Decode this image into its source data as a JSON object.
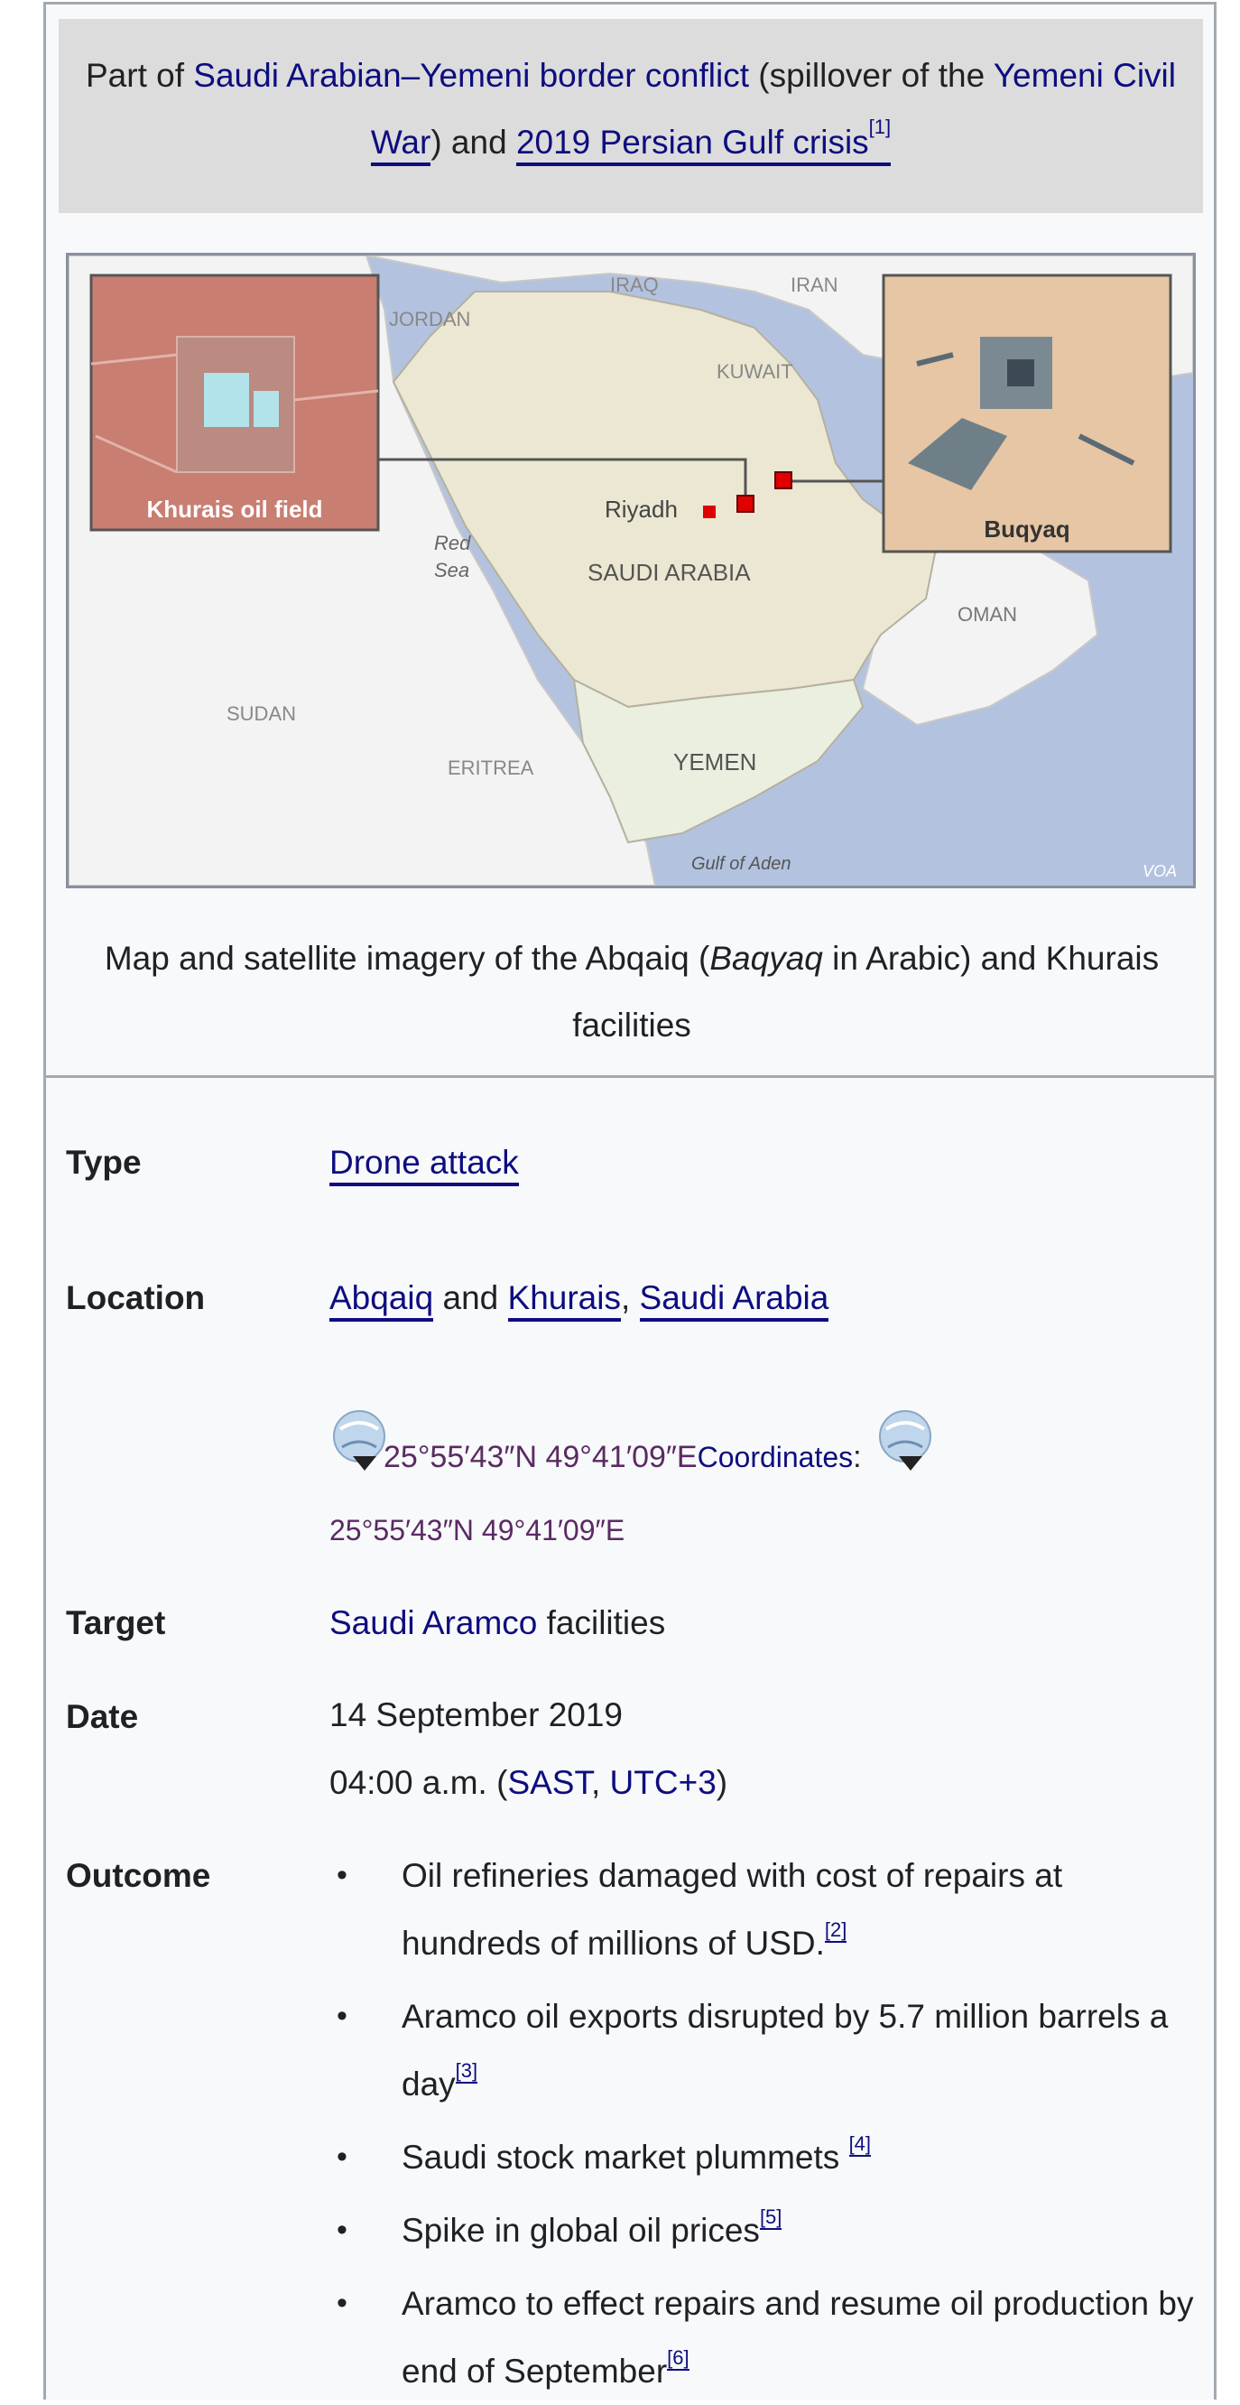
{
  "above": {
    "prefix": "Part of ",
    "link1": "Saudi Arabian–Yemeni border conflict",
    "middle": " (spillover of the ",
    "link2a": "Yemeni Civil",
    "link2b": "War",
    "close": ")",
    "and": " and ",
    "link3": "2019 Persian Gulf crisis",
    "ref": "[1]"
  },
  "map": {
    "labels": {
      "iraq": "IRAQ",
      "iran": "IRAN",
      "jordan": "JORDAN",
      "kuwait": "KUWAIT",
      "riyadh": "Riyadh",
      "red_sea_1": "Red",
      "red_sea_2": "Sea",
      "saudi": "SAUDI ARABIA",
      "oman": "OMAN",
      "sudan": "SUDAN",
      "eritrea": "ERITREA",
      "yemen": "YEMEN",
      "gulf_aden": "Gulf of Aden",
      "credit": "VOA",
      "khurais_inset": "Khurais oil field",
      "buqyaq_inset": "Buqyaq"
    },
    "colors": {
      "sea": "#b3c3df",
      "saudi": "#ece7d2",
      "yemen": "#eaefe0",
      "land": "#f3f3f3",
      "marker": "#e00000"
    }
  },
  "caption": {
    "part1": "Map and satellite imagery of the Abqaiq (",
    "italic": "Baqyaq",
    "part2": " in Arabic) and Khurais",
    "part3": "facilities"
  },
  "rows": {
    "type": {
      "label": "Type",
      "value": "Drone attack"
    },
    "location": {
      "label": "Location",
      "abqaiq": "Abqaiq",
      "and": " and ",
      "khurais": "Khurais",
      "comma": ", ",
      "saudi_arabia": "Saudi Arabia",
      "coord1": "25°55′43″N 49°41′09″E",
      "coord_label": "Coordinates",
      "colon": ":",
      "coord2": "25°55′43″N 49°41′09″E"
    },
    "target": {
      "label": "Target",
      "link": "Saudi Aramco",
      "rest": " facilities"
    },
    "date": {
      "label": "Date",
      "line1": "14 September 2019",
      "line2_pre": "04:00 a.m. (",
      "sast": "SAST",
      "sep": ", ",
      "utc": "UTC+3",
      "line2_post": ")"
    },
    "outcome": {
      "label": "Outcome",
      "items": [
        {
          "text": "Oil refineries damaged with cost of repairs at hundreds of millions of USD.",
          "ref": "[2]"
        },
        {
          "text": "Aramco oil exports disrupted by 5.7 million barrels a day",
          "ref": "[3]"
        },
        {
          "text": "Saudi stock market plummets ",
          "ref": "[4]"
        },
        {
          "text": "Spike in global oil prices",
          "ref": "[5]"
        },
        {
          "text": "Aramco to effect repairs and resume oil production by end of September",
          "ref": "[6]"
        }
      ]
    }
  }
}
